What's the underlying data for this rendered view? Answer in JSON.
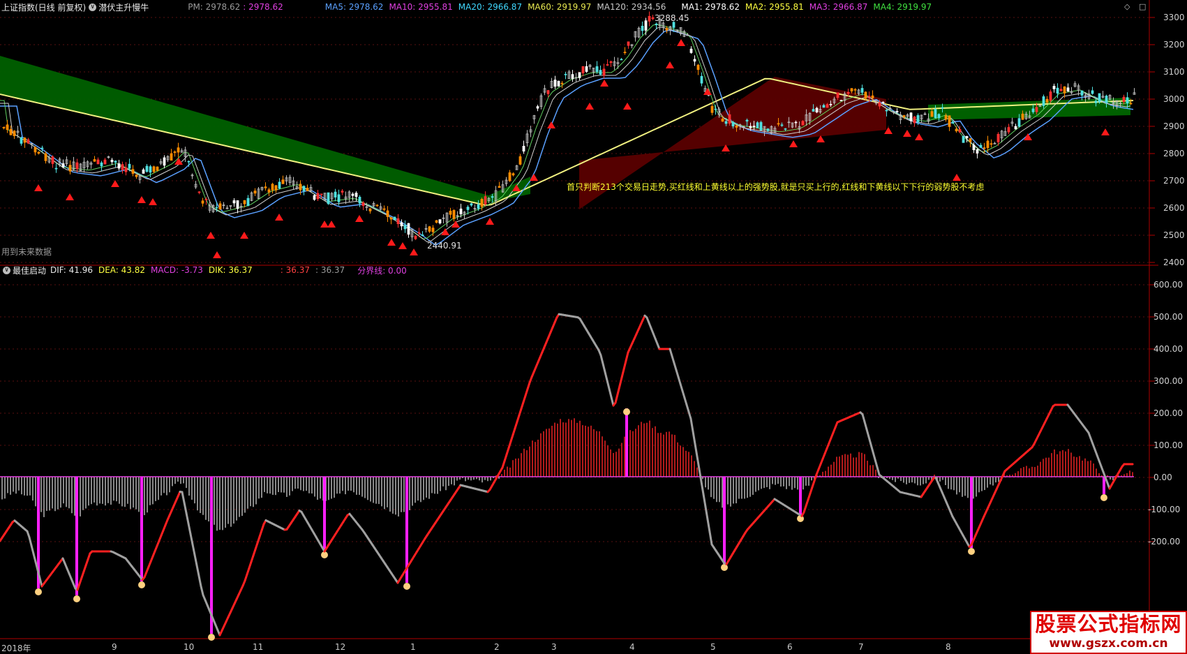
{
  "window": {
    "index_name": "上证指数(日线 前复权)",
    "indicator_name": "潜伏主升慢牛",
    "pm_label": "PM: 2978.62",
    "pm_value": ": 2978.62",
    "tool_diamond": "◇",
    "tool_box": "□"
  },
  "ma_legend_left": [
    {
      "text": "MA5: 2978.62",
      "color": "#5aa0ff"
    },
    {
      "text": "MA10: 2955.81",
      "color": "#e040e0"
    },
    {
      "text": "MA20: 2966.87",
      "color": "#40d8ff"
    },
    {
      "text": "MA60: 2919.97",
      "color": "#e8e850"
    },
    {
      "text": "MA120: 2934.56",
      "color": "#c8c8c8"
    }
  ],
  "ma_legend_right": [
    {
      "text": "MA1: 2978.62",
      "color": "#ffffff"
    },
    {
      "text": "MA2: 2955.81",
      "color": "#ffff40"
    },
    {
      "text": "MA3: 2966.87",
      "color": "#e040e0"
    },
    {
      "text": "MA4: 2919.97",
      "color": "#40e040"
    }
  ],
  "price_axis": [
    "3300",
    "3200",
    "3100",
    "3000",
    "2900",
    "2800",
    "2700",
    "2600",
    "2500",
    "2400"
  ],
  "annotations": {
    "high_label": "3288.45",
    "low_label": "2440.91",
    "future_data_note": "用到未来数据",
    "strategy_note": "首只判断213个交易日走势,买红线和上黄线以上的强势股,就是只买上行的,红线和下黄线以下下行的弱势股不考虑"
  },
  "sub_panel": {
    "name": "最佳启动",
    "dif": "DIF: 41.96",
    "dea": "DEA: 43.82",
    "macd": "MACD: -3.73",
    "dik": "DIK: 36.37",
    "val1": ": 36.37",
    "val2": ": 36.37",
    "boundary": "分界线: 0.00"
  },
  "sub_axis": [
    "600.00",
    "500.00",
    "400.00",
    "300.00",
    "200.00",
    "100.00",
    "0.00",
    "-100.00",
    "-200.00"
  ],
  "x_axis": [
    "2018年",
    "9",
    "10",
    "11",
    "12",
    "1",
    "2",
    "3",
    "4",
    "5",
    "6",
    "7",
    "8"
  ],
  "colors": {
    "up": "#ff3030",
    "down": "#50e0e0",
    "axis_red": "#b00000",
    "green_band": "#006000",
    "red_band": "#5a0000",
    "yellow_line": "#f0f080",
    "blue_line": "#5aa0ff"
  },
  "watermark": {
    "line1": "股票公式指标网",
    "line2": "www.gszx.com.cn"
  }
}
